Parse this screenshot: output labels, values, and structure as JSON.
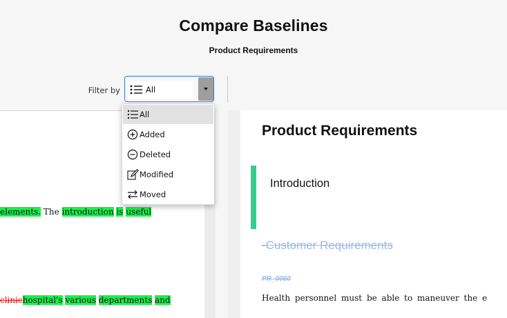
{
  "header": {
    "title": "Compare Baselines",
    "subtitle": "Product Requirements"
  },
  "filter": {
    "label": "Filter by",
    "selected_value": "All",
    "selected_icon": "list-icon",
    "options": [
      {
        "label": "All",
        "icon": "list-icon",
        "selected": true
      },
      {
        "label": "Added",
        "icon": "plus-circle-icon",
        "selected": false
      },
      {
        "label": "Deleted",
        "icon": "minus-circle-icon",
        "selected": false
      },
      {
        "label": "Modified",
        "icon": "edit-icon",
        "selected": false
      },
      {
        "label": "Moved",
        "icon": "arrows-swap-icon",
        "selected": false
      }
    ]
  },
  "left_pane": {
    "line1": [
      {
        "text": "elements.",
        "style": "hl"
      },
      {
        "text": " The ",
        "style": "plain"
      },
      {
        "text": "introduction",
        "style": "hl"
      },
      {
        "text": " ",
        "style": "plain"
      },
      {
        "text": "is",
        "style": "hl"
      },
      {
        "text": " ",
        "style": "plain"
      },
      {
        "text": "useful",
        "style": "hl"
      }
    ],
    "line2": [
      {
        "text": "clinic",
        "style": "del"
      },
      {
        "text": "hospital's",
        "style": "hl"
      },
      {
        "text": " ",
        "style": "plain"
      },
      {
        "text": "various",
        "style": "hl"
      },
      {
        "text": " ",
        "style": "plain"
      },
      {
        "text": "departments",
        "style": "hl"
      },
      {
        "text": " ",
        "style": "plain"
      },
      {
        "text": "and",
        "style": "hl"
      }
    ]
  },
  "right_pane": {
    "doc_title": "Product Requirements",
    "intro_heading": "Introduction",
    "deleted_heading": "-Customer Requirements",
    "deleted_id": "PR_0060",
    "body_line": "Health personnel must be able to maneuver the e"
  },
  "colors": {
    "accent_blue": "#2f7ad6",
    "added_green": "#19f04a",
    "moved_bar": "#2fd08c",
    "deleted_blue": "#9bb9e6",
    "deleted_red": "#d11"
  }
}
